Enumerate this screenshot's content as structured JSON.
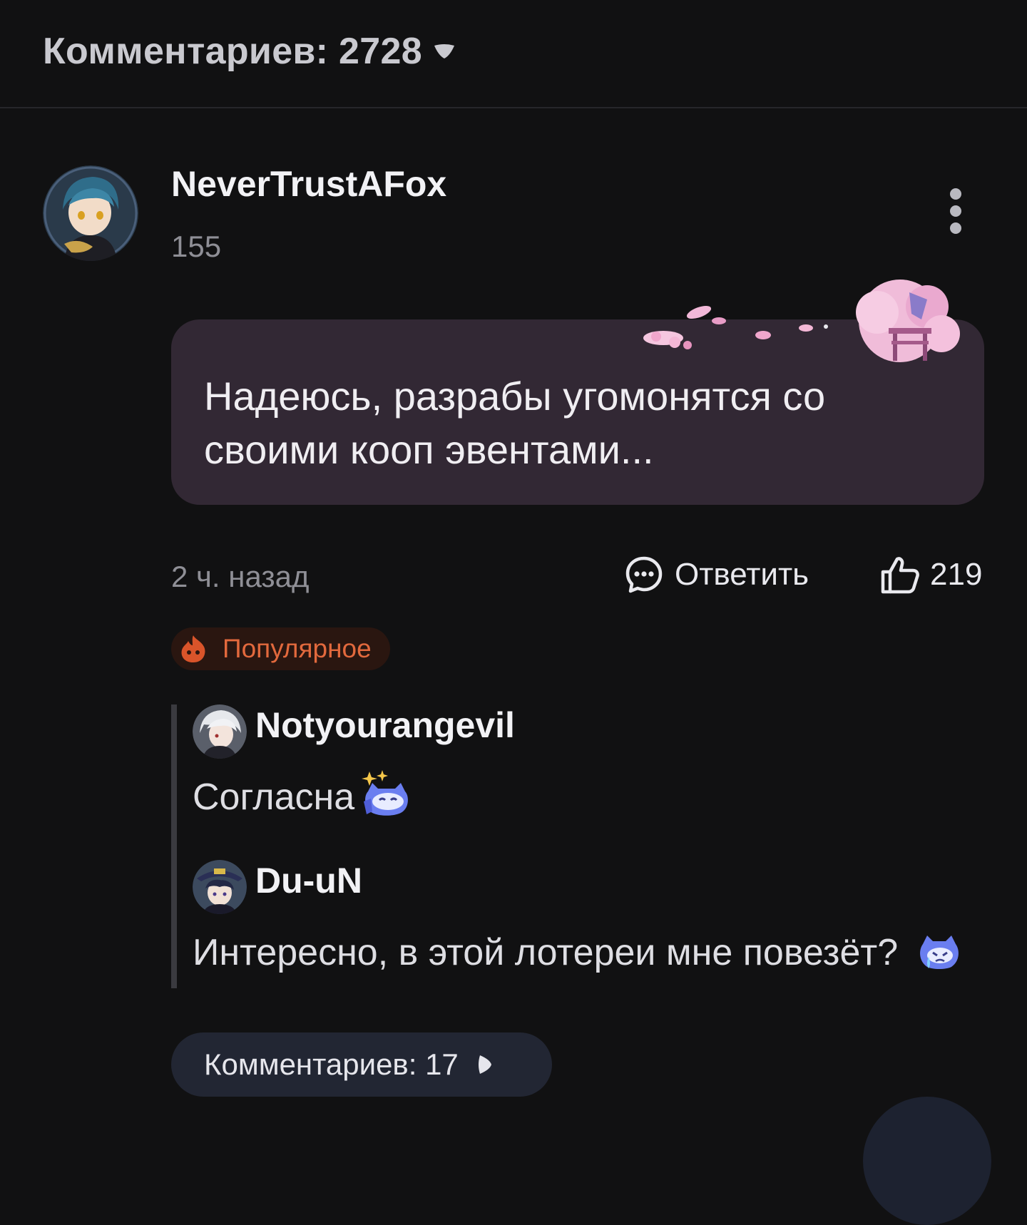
{
  "header": {
    "comments_title": "Комментариев: 2728"
  },
  "comment": {
    "author": "NeverTrustAFox",
    "level": "155",
    "text": "Надеюсь, разрабы угомонятся со своими кооп эвентами...",
    "timestamp": "2 ч. назад",
    "reply_label": "Ответить",
    "likes": "219",
    "badge": "Популярное"
  },
  "replies": [
    {
      "author": "Notyourangevil",
      "text": "Согласна",
      "emoji": "sparkle-cat-sticker"
    },
    {
      "author": "Du-uN",
      "text": "Интересно, в этой лотереи мне повезёт?",
      "emoji": "crying-cat-sticker"
    }
  ],
  "footer": {
    "more_comments_label": "Комментариев: 17"
  },
  "colors": {
    "background": "#111112",
    "bubble": "#322834",
    "badge_text": "#e2693d",
    "button_bg": "#222633"
  }
}
